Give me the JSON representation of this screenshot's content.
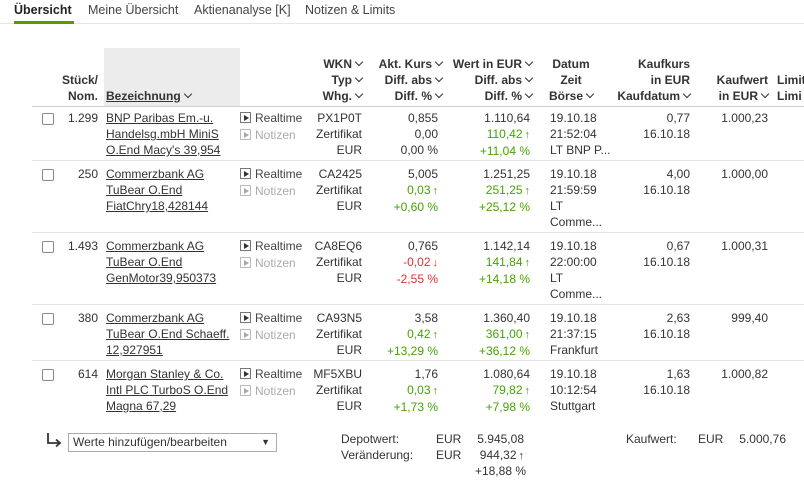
{
  "tabs": [
    {
      "label": "Übersicht"
    },
    {
      "label": "Meine Übersicht"
    },
    {
      "label": "Aktienanalyse [K]"
    },
    {
      "label": "Notizen & Limits"
    }
  ],
  "headers": {
    "stueck": "Stück/",
    "nom": "Nom.",
    "bezeichnung": "Bezeichnung",
    "wkn": "WKN",
    "typ": "Typ",
    "whg": "Whg.",
    "kurs": "Akt. Kurs",
    "diff_abs": "Diff. abs",
    "diff_pct": "Diff. %",
    "wert_eur": "Wert in EUR",
    "wert_diff_abs": "Diff. abs",
    "wert_diff_pct": "Diff. %",
    "datum": "Datum",
    "zeit": "Zeit",
    "boerse": "Börse",
    "kaufkurs": "Kaufkurs",
    "in_eur": "in EUR",
    "kaufdatum": "Kaufdatum",
    "kaufwert": "Kaufwert",
    "kaufwert_eur": "in EUR",
    "limit1": "Limit",
    "limit2": "Limi"
  },
  "actions": {
    "realtime": "Realtime",
    "notizen": "Notizen"
  },
  "rows": [
    {
      "qty": "1.299",
      "name": [
        "BNP Paribas Em.-u.",
        "Handelsg.mbH MiniS",
        "O.End Macy's 39,954"
      ],
      "wkn": "PX1P0T",
      "typ": "Zertifikat",
      "whg": "EUR",
      "kurs": "0,855",
      "diff_abs": "0,00",
      "diff_pct": "0,00 %",
      "diff_dir": "none",
      "wert": "1.110,64",
      "wert_abs": "110,42",
      "wert_pct": "+11,04 %",
      "datum": "19.10.18",
      "zeit": "21:52:04",
      "boerse": [
        "LT BNP P..."
      ],
      "kaufkurs": "0,77",
      "kaufdatum": "16.10.18",
      "kaufwert": "1.000,23"
    },
    {
      "qty": "250",
      "name": [
        "Commerzbank AG",
        "TuBear O.End",
        "FiatChry18,428144"
      ],
      "wkn": "CA2425",
      "typ": "Zertifikat",
      "whg": "EUR",
      "kurs": "5,005",
      "diff_abs": "0,03",
      "diff_pct": "+0,60 %",
      "diff_dir": "up",
      "wert": "1.251,25",
      "wert_abs": "251,25",
      "wert_pct": "+25,12 %",
      "datum": "19.10.18",
      "zeit": "21:59:59",
      "boerse": [
        "LT",
        "Comme..."
      ],
      "kaufkurs": "4,00",
      "kaufdatum": "16.10.18",
      "kaufwert": "1.000,00"
    },
    {
      "qty": "1.493",
      "name": [
        "Commerzbank AG",
        "TuBear O.End",
        "GenMotor39,950373"
      ],
      "wkn": "CA8EQ6",
      "typ": "Zertifikat",
      "whg": "EUR",
      "kurs": "0,765",
      "diff_abs": "-0,02",
      "diff_pct": "-2,55 %",
      "diff_dir": "down",
      "wert": "1.142,14",
      "wert_abs": "141,84",
      "wert_pct": "+14,18 %",
      "datum": "19.10.18",
      "zeit": "22:00:00",
      "boerse": [
        "LT",
        "Comme..."
      ],
      "kaufkurs": "0,67",
      "kaufdatum": "16.10.18",
      "kaufwert": "1.000,31"
    },
    {
      "qty": "380",
      "name": [
        "Commerzbank AG",
        "TuBear O.End Schaeff.",
        "12,927951"
      ],
      "wkn": "CA93N5",
      "typ": "Zertifikat",
      "whg": "EUR",
      "kurs": "3,58",
      "diff_abs": "0,42",
      "diff_pct": "+13,29 %",
      "diff_dir": "up",
      "wert": "1.360,40",
      "wert_abs": "361,00",
      "wert_pct": "+36,12 %",
      "datum": "19.10.18",
      "zeit": "21:37:15",
      "boerse": [
        "Frankfurt"
      ],
      "kaufkurs": "2,63",
      "kaufdatum": "16.10.18",
      "kaufwert": "999,40"
    },
    {
      "qty": "614",
      "name": [
        "Morgan Stanley & Co.",
        "Intl PLC TurboS O.End",
        "Magna 67,29"
      ],
      "wkn": "MF5XBU",
      "typ": "Zertifikat",
      "whg": "EUR",
      "kurs": "1,76",
      "diff_abs": "0,03",
      "diff_pct": "+1,73 %",
      "diff_dir": "up",
      "wert": "1.080,64",
      "wert_abs": "79,82",
      "wert_pct": "+7,98 %",
      "datum": "19.10.18",
      "zeit": "10:12:54",
      "boerse": [
        "Stuttgart"
      ],
      "kaufkurs": "1,63",
      "kaufdatum": "16.10.18",
      "kaufwert": "1.000,82"
    }
  ],
  "footer": {
    "select_value": "Werte hinzufügen/bearbeiten",
    "depotwert_label": "Depotwert:",
    "veraenderung_label": "Veränderung:",
    "currency": "EUR",
    "depotwert": "5.945,08",
    "veraenderung": "944,32",
    "veraenderung_pct": "+18,88 %",
    "kaufwert_label": "Kaufwert:",
    "kaufwert": "5.000,76"
  },
  "colors": {
    "positive": "#44a400",
    "negative": "#e03030",
    "tab_underline": "#5a9a00"
  }
}
